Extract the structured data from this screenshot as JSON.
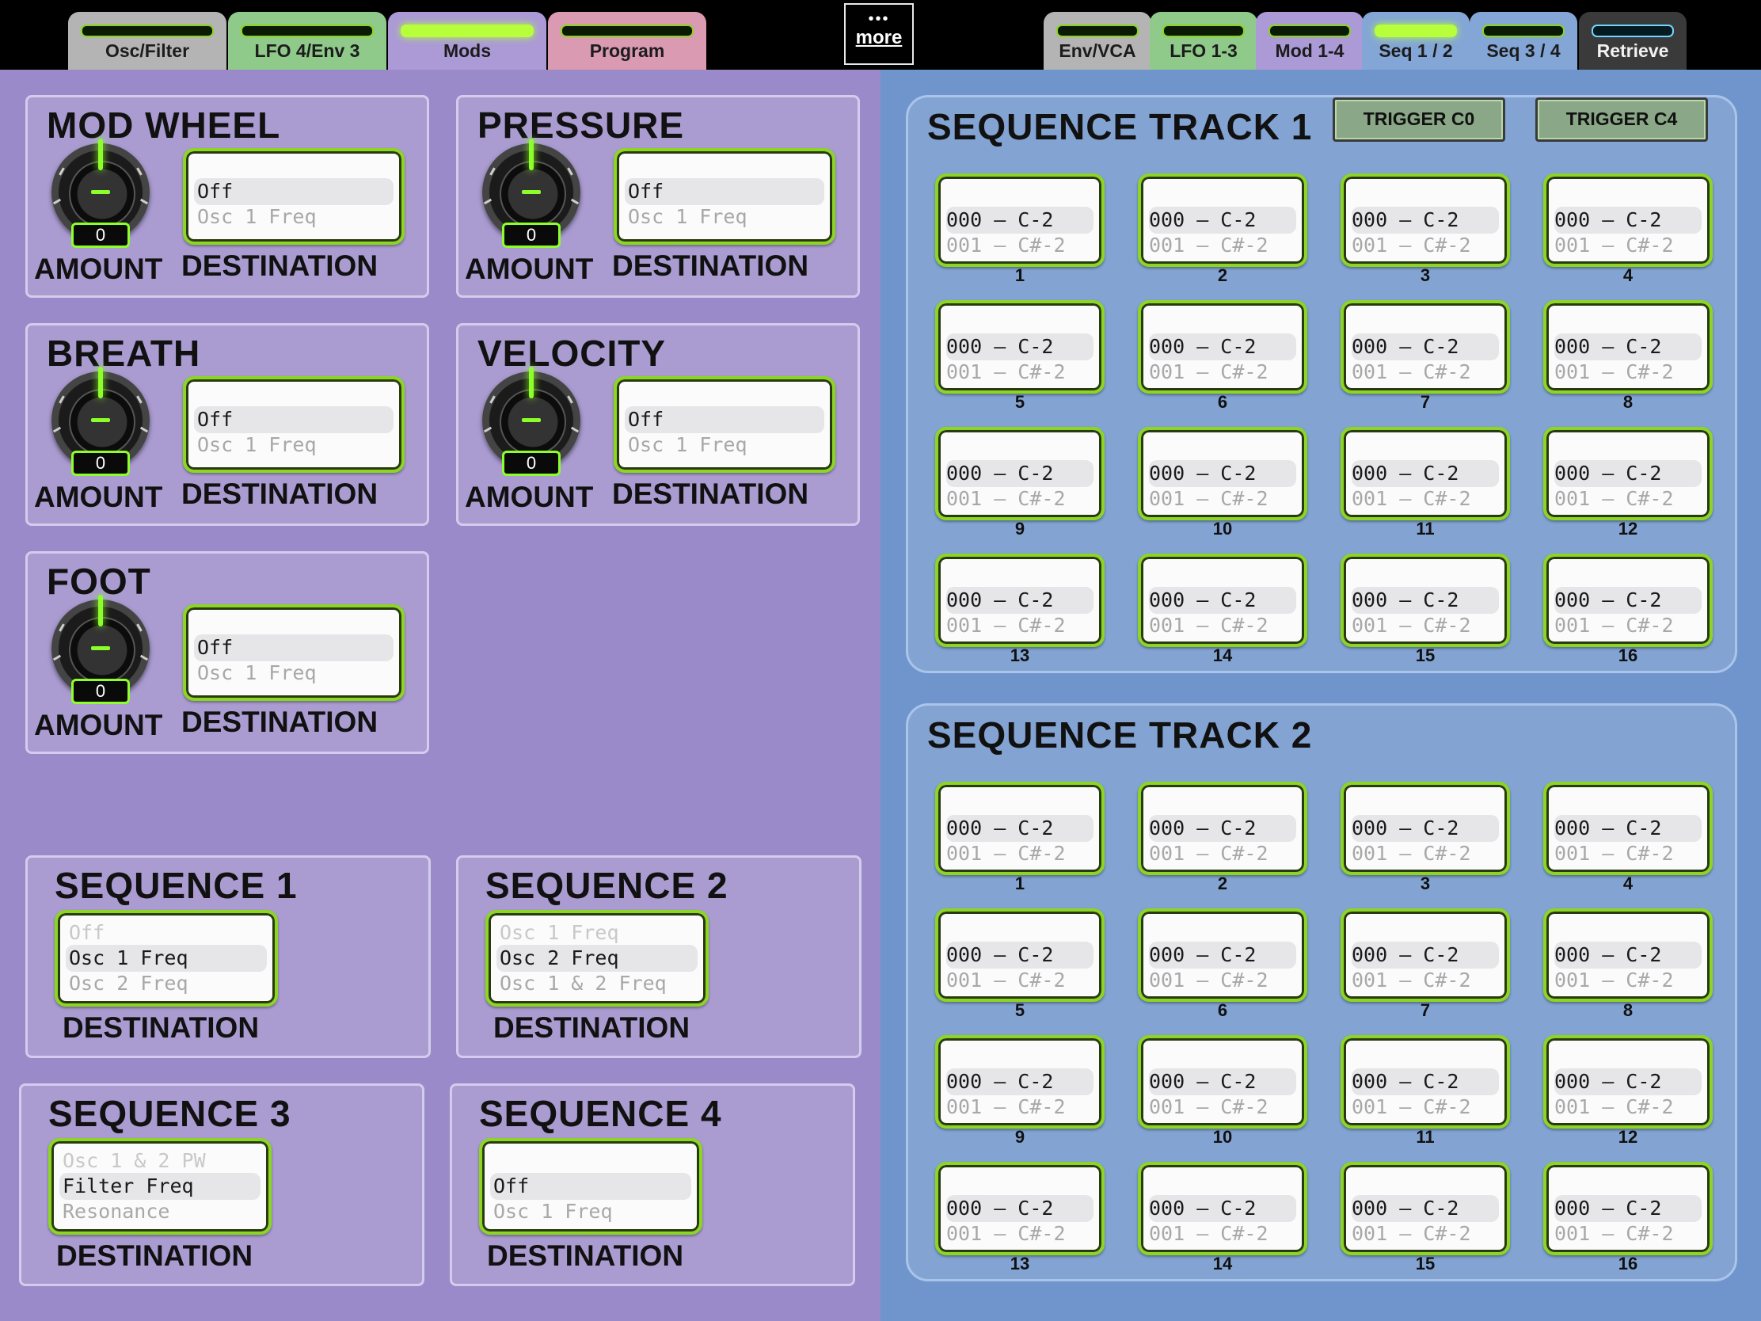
{
  "left_tabs": [
    {
      "label": "Osc/Filter",
      "active": false
    },
    {
      "label": "LFO 4/Env 3",
      "active": false
    },
    {
      "label": "Mods",
      "active": true
    },
    {
      "label": "Program",
      "active": false
    }
  ],
  "more_label": "more",
  "right_tabs": [
    {
      "label": "Env/VCA",
      "active": false
    },
    {
      "label": "LFO 1-3",
      "active": false
    },
    {
      "label": "Mod 1-4",
      "active": false
    },
    {
      "label": "Seq 1 / 2",
      "active": true
    },
    {
      "label": "Seq 3 / 4",
      "active": false
    },
    {
      "label": "Retrieve",
      "active": false
    }
  ],
  "colors": {
    "accent_green": "#8cd623",
    "left_bg": "#9a8ac9",
    "right_bg": "#6f95cc"
  },
  "labels": {
    "amount": "AMOUNT",
    "destination": "DESTINATION"
  },
  "mod_sources": [
    {
      "title": "MOD WHEEL",
      "amount": "0",
      "dest_rows": [
        "Off",
        "Osc 1 Freq"
      ]
    },
    {
      "title": "PRESSURE",
      "amount": "0",
      "dest_rows": [
        "Off",
        "Osc 1 Freq"
      ]
    },
    {
      "title": "BREATH",
      "amount": "0",
      "dest_rows": [
        "Off",
        "Osc 1 Freq"
      ]
    },
    {
      "title": "VELOCITY",
      "amount": "0",
      "dest_rows": [
        "Off",
        "Osc 1 Freq"
      ]
    },
    {
      "title": "FOOT",
      "amount": "0",
      "dest_rows": [
        "Off",
        "Osc 1 Freq"
      ]
    }
  ],
  "sequences": [
    {
      "title": "SEQUENCE 1",
      "above": "Off",
      "selected": "Osc 1 Freq",
      "below": "Osc 2 Freq"
    },
    {
      "title": "SEQUENCE 2",
      "above": "Osc 1 Freq",
      "selected": "Osc 2 Freq",
      "below": "Osc 1 & 2 Freq"
    },
    {
      "title": "SEQUENCE 3",
      "above": "Osc 1 & 2 PW",
      "selected": "Filter Freq",
      "below": "Resonance"
    },
    {
      "title": "SEQUENCE 4",
      "above": "",
      "selected": "Off",
      "below": "Osc 1 Freq"
    }
  ],
  "track1": {
    "title": "SEQUENCE TRACK 1",
    "trigger_buttons": [
      "TRIGGER C0",
      "TRIGGER C4"
    ],
    "step_value": "000 – C-2",
    "step_next": "001 – C#-2",
    "steps": [
      "1",
      "2",
      "3",
      "4",
      "5",
      "6",
      "7",
      "8",
      "9",
      "10",
      "11",
      "12",
      "13",
      "14",
      "15",
      "16"
    ]
  },
  "track2": {
    "title": "SEQUENCE TRACK 2",
    "step_value": "000 – C-2",
    "step_next": "001 – C#-2",
    "steps": [
      "1",
      "2",
      "3",
      "4",
      "5",
      "6",
      "7",
      "8",
      "9",
      "10",
      "11",
      "12",
      "13",
      "14",
      "15",
      "16"
    ]
  }
}
